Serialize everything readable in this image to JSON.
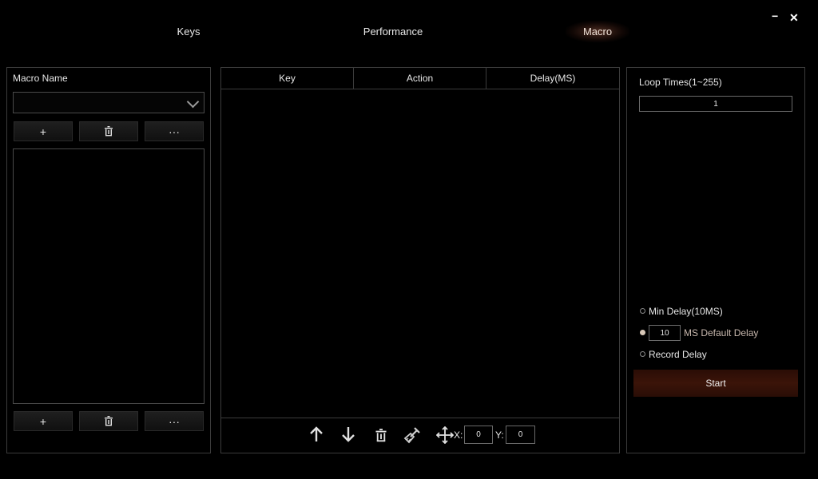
{
  "window": {
    "minimize": "−",
    "close": "✕"
  },
  "tabs": [
    {
      "label": "Keys"
    },
    {
      "label": "Performance"
    },
    {
      "label": "Macro"
    }
  ],
  "macro_panel": {
    "title": "Macro Name",
    "selected": "",
    "add_icon": "+",
    "delete_icon": "trash-icon",
    "more_icon": "···"
  },
  "events_table": {
    "columns": [
      "Key",
      "Action",
      "Delay(MS)"
    ],
    "rows": [],
    "toolbar": {
      "x_label": "X:",
      "x_value": "0",
      "y_label": "Y:",
      "y_value": "0"
    }
  },
  "settings": {
    "loop_label": "Loop Times(1~255)",
    "loop_value": "1",
    "min_delay_label": "Min Delay(10MS)",
    "default_delay_value": "10",
    "default_delay_label": "MS Default Delay",
    "record_delay_label": "Record Delay",
    "selected_delay_mode": "default",
    "start_label": "Start"
  },
  "colors": {
    "accent": "#3b1409",
    "active_radio": "#d8c8b8"
  }
}
